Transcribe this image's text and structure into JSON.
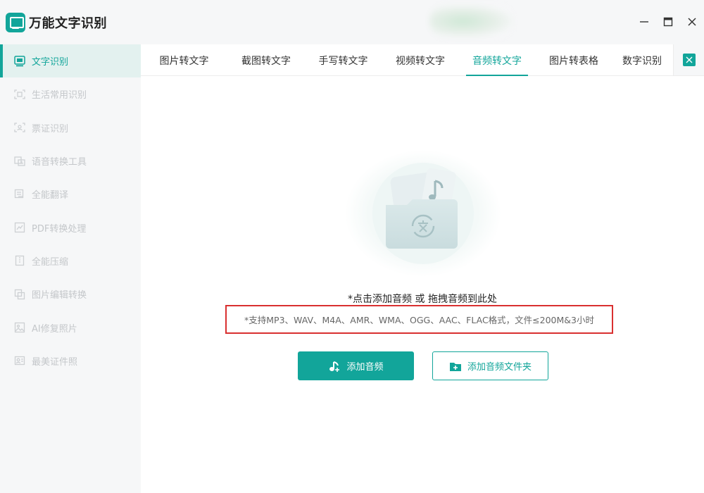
{
  "app": {
    "title": "万能文字识别",
    "colors": {
      "accent": "#12a59a",
      "highlight_border": "#d93030",
      "inactive_text": "#c4c7ca"
    }
  },
  "sidebar": {
    "items": [
      {
        "label": "文字识别",
        "icon": "text-recognition-icon",
        "active": true
      },
      {
        "label": "生活常用识别",
        "icon": "scan-icon"
      },
      {
        "label": "票证识别",
        "icon": "ticket-scan-icon"
      },
      {
        "label": "语音转换工具",
        "icon": "voice-convert-icon"
      },
      {
        "label": "全能翻译",
        "icon": "translate-icon"
      },
      {
        "label": "PDF转换处理",
        "icon": "pdf-icon"
      },
      {
        "label": "全能压缩",
        "icon": "compress-icon"
      },
      {
        "label": "图片编辑转换",
        "icon": "image-edit-icon"
      },
      {
        "label": "AI修复照片",
        "icon": "ai-photo-icon"
      },
      {
        "label": "最美证件照",
        "icon": "id-photo-icon"
      }
    ]
  },
  "window": {
    "controls": [
      "minimize-icon",
      "maximize-icon",
      "close-icon"
    ]
  },
  "tabs": {
    "items": [
      {
        "label": "图片转文字"
      },
      {
        "label": "截图转文字"
      },
      {
        "label": "手写转文字"
      },
      {
        "label": "视频转文字"
      },
      {
        "label": "音频转文字",
        "active": true
      },
      {
        "label": "图片转表格"
      },
      {
        "label": "数字识别"
      }
    ],
    "more_icon": "collapse-icon"
  },
  "main": {
    "drop_hint": "*点击添加音频 或 拖拽音频到此处",
    "formats": "*支持MP3、WAV、M4A、AMR、WMA、OGG、AAC、FLAC格式，文件≤200M&3小时",
    "add_audio_label": "添加音频",
    "add_audio_icon": "music-add-icon",
    "add_folder_label": "添加音频文件夹",
    "add_folder_icon": "folder-add-icon"
  }
}
